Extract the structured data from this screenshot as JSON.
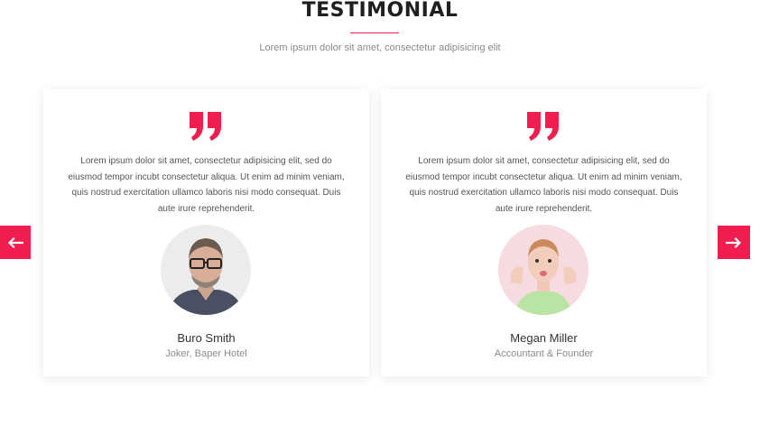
{
  "section": {
    "title": "TESTIMONIAL",
    "subtitle": "Lorem ipsum dolor sit amet, consectetur adipisicing elit"
  },
  "colors": {
    "accent": "#f01d4e",
    "text": "#555555",
    "muted": "#8a8a8a"
  },
  "icons": {
    "quote": "quote-icon",
    "prev": "arrow-left-icon",
    "next": "arrow-right-icon"
  },
  "testimonials": [
    {
      "quote": "Lorem ipsum dolor sit amet, consectetur adipisicing elit, sed do eiusmod tempor incubt consectetur aliqua. Ut enim ad minim veniam, quis nostrud exercitation ullamco laboris nisi modo consequat. Duis aute irure reprehenderit.",
      "name": "Buro Smith",
      "role": "Joker, Baper Hotel"
    },
    {
      "quote": "Lorem ipsum dolor sit amet, consectetur adipisicing elit, sed do eiusmod tempor incubt consectetur aliqua. Ut enim ad minim veniam, quis nostrud exercitation ullamco laboris nisi modo consequat. Duis aute irure reprehenderit.",
      "name": "Megan Miller",
      "role": "Accountant & Founder"
    }
  ]
}
